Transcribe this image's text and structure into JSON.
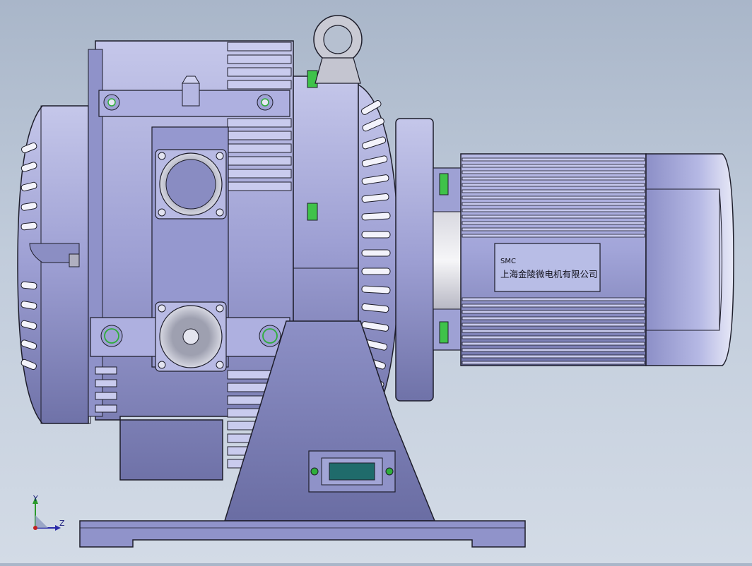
{
  "model": {
    "nameplate": {
      "brand": "SMC",
      "manufacturer": "上海金陵微电机有限公司"
    },
    "colors": {
      "body": "#9b9fd2",
      "body_dark": "#6d70a6",
      "body_light": "#c4c6ea",
      "outline": "#1d1d2a",
      "nameplate": "#b8bde6",
      "display": "#1f6b6b",
      "fastener_green": "#2fae3c"
    }
  },
  "triad": {
    "x_label": "X",
    "y_label": "Y",
    "z_label": "Z"
  }
}
